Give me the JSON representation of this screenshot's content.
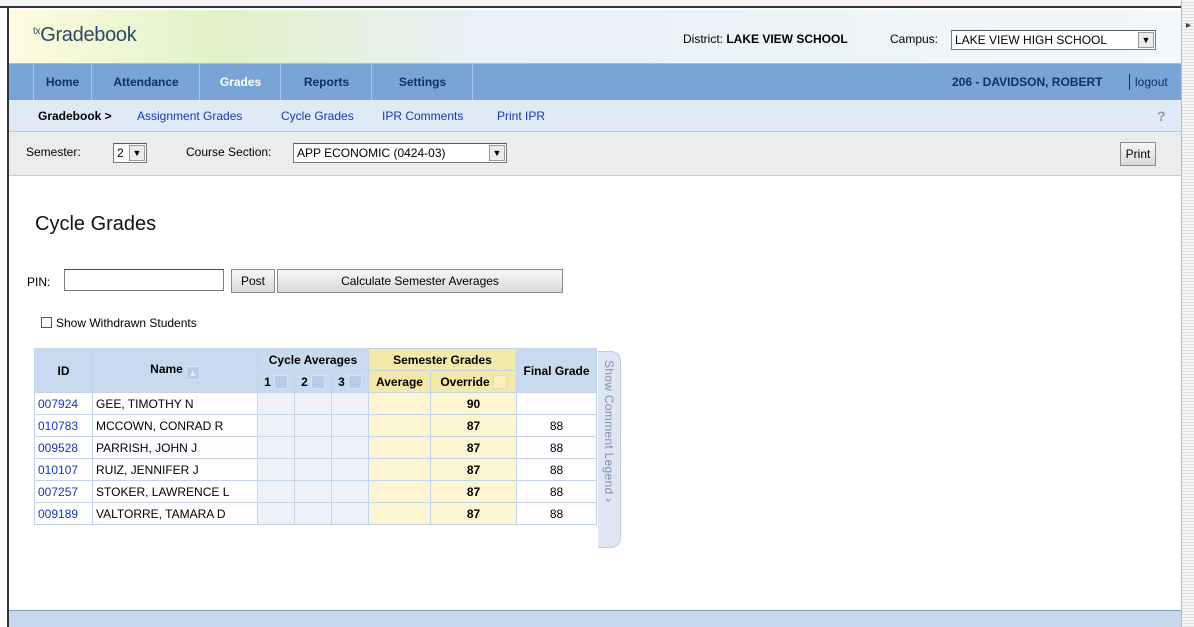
{
  "header": {
    "logo_prefix": "tx",
    "logo_text": "Gradebook",
    "district_label": "District:",
    "district_value": "LAKE VIEW SCHOOL",
    "campus_label": "Campus:",
    "campus_value": "LAKE VIEW HIGH SCHOOL"
  },
  "nav": {
    "items": [
      {
        "label": "Home"
      },
      {
        "label": "Attendance"
      },
      {
        "label": "Grades"
      },
      {
        "label": "Reports"
      },
      {
        "label": "Settings"
      }
    ],
    "active": "Grades",
    "user": "206 - DAVIDSON, ROBERT",
    "logout": "logout"
  },
  "subnav": {
    "crumb": "Gradebook >",
    "links": [
      "Assignment Grades",
      "Cycle Grades",
      "IPR Comments",
      "Print IPR"
    ]
  },
  "filters": {
    "semester_label": "Semester:",
    "semester_value": "2",
    "course_label": "Course Section:",
    "course_value": "APP ECONOMIC (0424-03)",
    "print_label": "Print"
  },
  "main": {
    "title": "Cycle Grades",
    "pin_label": "PIN:",
    "post_label": "Post",
    "calc_label": "Calculate Semester Averages",
    "show_withdrawn_label": "Show Withdrawn Students",
    "show_withdrawn_checked": false
  },
  "grid": {
    "headers": {
      "id": "ID",
      "name": "Name",
      "cycle_averages": "Cycle Averages",
      "cycles": [
        "1",
        "2",
        "3"
      ],
      "semester_grades": "Semester Grades",
      "average": "Average",
      "override": "Override",
      "final_grade": "Final Grade"
    },
    "rows": [
      {
        "id": "007924",
        "name": "GEE, TIMOTHY N",
        "override": "90",
        "final": ""
      },
      {
        "id": "010783",
        "name": "MCCOWN, CONRAD R",
        "override": "87",
        "final": "88"
      },
      {
        "id": "009528",
        "name": "PARRISH, JOHN J",
        "override": "87",
        "final": "88"
      },
      {
        "id": "010107",
        "name": "RUIZ, JENNIFER J",
        "override": "87",
        "final": "88"
      },
      {
        "id": "007257",
        "name": "STOKER, LAWRENCE L",
        "override": "87",
        "final": "88"
      },
      {
        "id": "009189",
        "name": "VALTORRE, TAMARA D",
        "override": "87",
        "final": "88"
      }
    ],
    "legend_tab": "Show Comment Legend"
  },
  "colors": {
    "nav_bg": "#7ba4d6",
    "link": "#1538b5",
    "semester_header": "#f3e8a8"
  }
}
